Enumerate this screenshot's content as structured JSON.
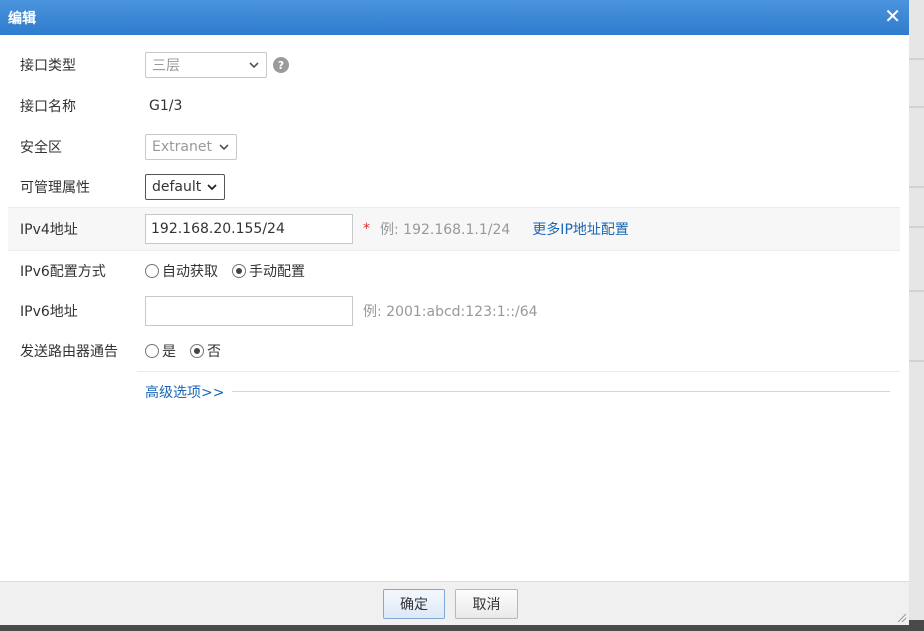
{
  "dialog": {
    "title": "编辑"
  },
  "form": {
    "interface_type": {
      "label": "接口类型",
      "value": "三层"
    },
    "interface_name": {
      "label": "接口名称",
      "value": "G1/3"
    },
    "security_zone": {
      "label": "安全区",
      "value": "Extranet"
    },
    "manage_attr": {
      "label": "可管理属性",
      "value": "default"
    },
    "ipv4": {
      "label": "IPv4地址",
      "value": "192.168.20.155/24",
      "required_mark": "*",
      "example": "例: 192.168.1.1/24",
      "more_link": "更多IP地址配置"
    },
    "ipv6_mode": {
      "label": "IPv6配置方式",
      "options": [
        {
          "label": "自动获取",
          "selected": false
        },
        {
          "label": "手动配置",
          "selected": true
        }
      ]
    },
    "ipv6_addr": {
      "label": "IPv6地址",
      "value": "",
      "example": "例: 2001:abcd:123:1::/64"
    },
    "router_advert": {
      "label": "发送路由器通告",
      "options": [
        {
          "label": "是",
          "selected": false
        },
        {
          "label": "否",
          "selected": true
        }
      ]
    },
    "advanced_link": "高级选项>>"
  },
  "footer": {
    "ok_label": "确定",
    "cancel_label": "取消"
  },
  "colors": {
    "title_bar": "#3a86d6",
    "link": "#1a67b5",
    "required": "#d03030"
  }
}
